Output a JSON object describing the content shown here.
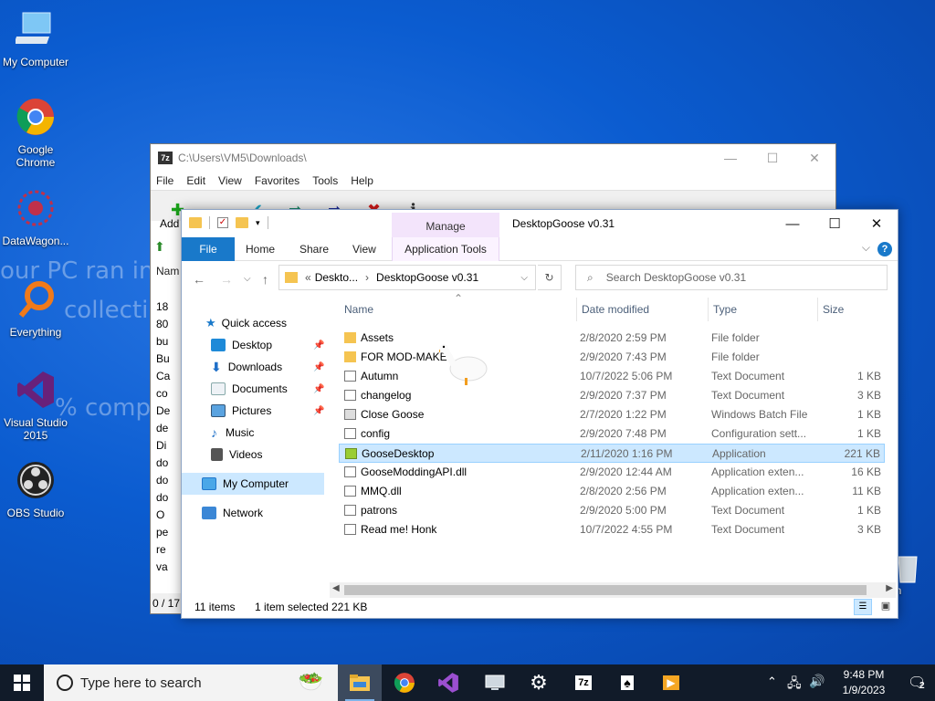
{
  "desktop": {
    "bg_text": [
      "our PC ran into",
      "collecting s",
      "% complete",
      ""
    ],
    "icons": [
      {
        "label": "My Computer",
        "icon": "computer-icon"
      },
      {
        "label": "Google Chrome",
        "icon": "chrome-icon"
      },
      {
        "label": "DataWagon...",
        "icon": "datawagon-icon"
      },
      {
        "label": "Everything",
        "icon": "everything-search-icon"
      },
      {
        "label": "Visual Studio 2015",
        "icon": "visual-studio-icon"
      },
      {
        "label": "OBS Studio",
        "icon": "obs-icon"
      }
    ],
    "recycle_label": "e Bin"
  },
  "zip": {
    "title": "C:\\Users\\VM5\\Downloads\\",
    "menu": [
      "File",
      "Edit",
      "View",
      "Favorites",
      "Tools",
      "Help"
    ],
    "add_label": "Add",
    "list_header": "Nam",
    "list": [
      "",
      "18",
      "80",
      "bu",
      "Bu",
      "Ca",
      "co",
      "De",
      "de",
      "Di",
      "do",
      "do",
      "do",
      "O",
      "pe",
      "re",
      "va"
    ],
    "status": "0 / 17"
  },
  "explorer": {
    "title": "DesktopGoose v0.31",
    "manage": "Manage",
    "tabs": [
      "File",
      "Home",
      "Share",
      "View",
      "Application Tools"
    ],
    "address": {
      "parent": "Deskto...",
      "current": "DesktopGoose v0.31"
    },
    "search_placeholder": "Search DesktopGoose v0.31",
    "nav": [
      {
        "label": "Quick access",
        "icon": "star-icon"
      },
      {
        "label": "Desktop",
        "icon": "desktop-icon"
      },
      {
        "label": "Downloads",
        "icon": "download-icon"
      },
      {
        "label": "Documents",
        "icon": "documents-icon"
      },
      {
        "label": "Pictures",
        "icon": "pictures-icon"
      },
      {
        "label": "Music",
        "icon": "music-icon"
      },
      {
        "label": "Videos",
        "icon": "videos-icon"
      },
      {
        "label": "My Computer",
        "icon": "computer-icon"
      },
      {
        "label": "Network",
        "icon": "network-icon"
      }
    ],
    "columns": [
      "Name",
      "Date modified",
      "Type",
      "Size"
    ],
    "files": [
      {
        "name": "Assets",
        "date": "2/8/2020 2:59 PM",
        "type": "File folder",
        "size": "",
        "kind": "folder"
      },
      {
        "name": "FOR MOD-MAKE",
        "date": "2/9/2020 7:43 PM",
        "type": "File folder",
        "size": "",
        "kind": "folder"
      },
      {
        "name": "Autumn",
        "date": "10/7/2022 5:06 PM",
        "type": "Text Document",
        "size": "1 KB",
        "kind": "doc"
      },
      {
        "name": "changelog",
        "date": "2/9/2020 7:37 PM",
        "type": "Text Document",
        "size": "3 KB",
        "kind": "doc"
      },
      {
        "name": "Close Goose",
        "date": "2/7/2020 1:22 PM",
        "type": "Windows Batch File",
        "size": "1 KB",
        "kind": "doc"
      },
      {
        "name": "config",
        "date": "2/9/2020 7:48 PM",
        "type": "Configuration sett...",
        "size": "1 KB",
        "kind": "doc"
      },
      {
        "name": "GooseDesktop",
        "date": "2/11/2020 1:16 PM",
        "type": "Application",
        "size": "221 KB",
        "kind": "app"
      },
      {
        "name": "GooseModdingAPI.dll",
        "date": "2/9/2020 12:44 AM",
        "type": "Application exten...",
        "size": "16 KB",
        "kind": "doc"
      },
      {
        "name": "MMQ.dll",
        "date": "2/8/2020 2:56 PM",
        "type": "Application exten...",
        "size": "11 KB",
        "kind": "doc"
      },
      {
        "name": "patrons",
        "date": "2/9/2020 5:00 PM",
        "type": "Text Document",
        "size": "1 KB",
        "kind": "doc"
      },
      {
        "name": "Read me! Honk",
        "date": "10/7/2022 4:55 PM",
        "type": "Text Document",
        "size": "3 KB",
        "kind": "doc"
      }
    ],
    "status": {
      "count": "11 items",
      "selected": "1 item selected",
      "size": "221 KB"
    }
  },
  "taskbar": {
    "search_placeholder": "Type here to search",
    "time": "9:48 PM",
    "date": "1/9/2023",
    "notifications": "2"
  }
}
